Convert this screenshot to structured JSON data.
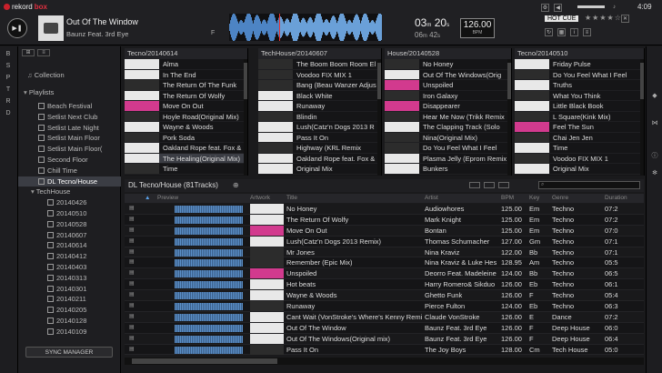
{
  "app": {
    "logo_prefix": "rekord",
    "logo_suffix": "box",
    "clock": "4:09"
  },
  "player": {
    "title": "Out Of The Window",
    "artist": "Baunz Feat. 3rd Eye",
    "key_short": "F",
    "time1": "03",
    "time1b": "20",
    "time2": "06",
    "time2b": "42",
    "bpm": "126.00",
    "bpm_label": "BPM",
    "stars": "★★★★☆",
    "hot_badge": "HOT CUE"
  },
  "sidebar": {
    "collection": "Collection",
    "playlists": "Playlists",
    "items": [
      "Beach Festival",
      "Setlist Next Club",
      "Setlist Late Night",
      "Setlist Main Floor",
      "Setlist Main Floor(",
      "Second Floor",
      "Chill Time",
      "DL Tecno/House",
      "TechHouse",
      "20140426",
      "20140510",
      "20140528",
      "20140607",
      "20140614",
      "20140412",
      "20140403",
      "20140313",
      "20140301",
      "20140211",
      "20140205",
      "20140128",
      "20140109"
    ],
    "sync": "SYNC MANAGER"
  },
  "panels": [
    {
      "title": "Tecno/20140614",
      "rows": [
        "Alma",
        "In The End",
        "The Return Of The Funk",
        "The Return Of Wolfy",
        "Move On Out",
        "Hoyle Road(Original Mix)",
        "Wayne & Woods",
        "Pork Soda",
        "Oakland Rope feat. Fox &",
        "The Healing(Original Mix)",
        "Time"
      ]
    },
    {
      "title": "TechHouse/20140607",
      "rows": [
        "The Boom Boom Room El",
        "Voodoo  FIX MIX 1",
        "Bang (Beau Wanzer Adjus",
        "Black White",
        "Runaway",
        "Blindin",
        "Lush(Catz'n Dogs 2013 R",
        "Pass It On",
        "Highway (KRL Remix",
        "Oakland Rope feat. Fox &",
        "Original Mix"
      ]
    },
    {
      "title": "House/20140528",
      "rows": [
        "No Honey",
        "Out Of The Windows(Orig",
        "Unspoiled",
        "Iron Galaxy",
        "Disappearer",
        "Hear Me Now (Trikk Remix",
        "The Clapping Track (Solo",
        "Nina(Original Mix)",
        "Do You Feel What I Feel",
        "Plasma Jelly (Eprom Remix",
        "Bunkers"
      ]
    },
    {
      "title": "Tecno/20140510",
      "rows": [
        "Friday Pulse",
        "Do You Feel What I Feel",
        "Truths",
        "What You Think",
        "Little Black Book",
        "L Square(Kink Mix)",
        "Feel The Sun",
        "Chai Jen Jen",
        "Time",
        "Voodoo  FIX MIX 1",
        "Original Mix"
      ]
    }
  ],
  "bottom": {
    "title": "DL Tecno/House (81Tracks)",
    "search_placeholder": "",
    "columns": [
      "Preview",
      "Artwork",
      "Title",
      "Artist",
      "BPM",
      "Key",
      "Genre",
      "Duration"
    ],
    "rows": [
      [
        "No Honey",
        "Audiowhores",
        "125.00",
        "Em",
        "Techno",
        "07:2"
      ],
      [
        "The Return Of Wolfy",
        "Mark Knight",
        "125.00",
        "Em",
        "Techno",
        "07:2"
      ],
      [
        "Move On Out",
        "Bontan",
        "125.00",
        "Em",
        "Techno",
        "07:0"
      ],
      [
        "Lush(Catz'n Dogs 2013 Remix)",
        "Thomas Schumacher",
        "127.00",
        "Gm",
        "Techno",
        "07:1"
      ],
      [
        "Mr Jones",
        "Nina Kraviz",
        "122.00",
        "Bb",
        "Techno",
        "07:1"
      ],
      [
        "Remember (Epic Mix)",
        "Nina Kraviz & Luke Hes",
        "128.95",
        "Am",
        "Techno",
        "05:5"
      ],
      [
        "Unspoiled",
        "Deorro Feat. Madeleine",
        "124.00",
        "Bb",
        "Techno",
        "06:5"
      ],
      [
        "Hot beats",
        "Harry Romero& Sikduo",
        "126.00",
        "Eb",
        "Techno",
        "06:1"
      ],
      [
        "Wayne & Woods",
        "Ghetto Funk",
        "126.00",
        "F",
        "Techno",
        "05:4"
      ],
      [
        "Runaway",
        "Pierce Fulton",
        "124.00",
        "Eb",
        "Techno",
        "06:3"
      ],
      [
        "Cant Wait (VonStroke's Where's Kenny Remi",
        "Claude VonStroke",
        "126.00",
        "E",
        "Dance",
        "07:2"
      ],
      [
        "Out Of The Window",
        "Baunz Feat. 3rd Eye",
        "126.00",
        "F",
        "Deep House",
        "06:0"
      ],
      [
        "Out Of The Windows(Original mix)",
        "Baunz Feat. 3rd Eye",
        "126.00",
        "F",
        "Deep House",
        "06:4"
      ],
      [
        "Pass It On",
        "The Joy Boys",
        "128.00",
        "Cm",
        "Tech House",
        "05:0"
      ]
    ]
  }
}
